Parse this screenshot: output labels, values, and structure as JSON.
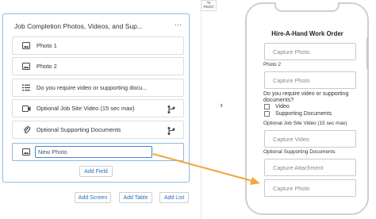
{
  "toolbar": {
    "redo_label": "REDO"
  },
  "editor": {
    "section_title": "Job Completion Photos, Videos, and Sup...",
    "menu_glyph": "…",
    "fields": [
      {
        "label": "Photo 1",
        "icon": "image-icon",
        "branch": false
      },
      {
        "label": "Photo 2",
        "icon": "image-icon",
        "branch": false
      },
      {
        "label": "Do you require video or supporting docu...",
        "icon": "list-icon",
        "branch": false
      },
      {
        "label": "Optional Job Site Video (15 sec max)",
        "icon": "video-icon",
        "branch": true
      },
      {
        "label": "Optional Supporting Documents",
        "icon": "paperclip-icon",
        "branch": true
      }
    ],
    "new_field": {
      "icon": "image-icon",
      "value": "",
      "placeholder": "New Photo"
    },
    "add_field_label": "Add Field"
  },
  "bottom_buttons": {
    "add_screen": "Add Screen",
    "add_table": "Add Table",
    "add_list": "Add List"
  },
  "phone": {
    "title": "Hire-A-Hand Work Order",
    "capture_photo_1": "Capture Photo",
    "photo2_label": "Photo 2",
    "capture_photo_2": "Capture Photo",
    "question_label": "Do you require video or supporting documents?",
    "options": [
      "Video",
      "Supporting Documents"
    ],
    "video_label": "Optional Job Site Video (15 sec max)",
    "capture_video": "Capture Video",
    "documents_label": "Optional Supporting Documents",
    "capture_attachment": "Capture Attachment",
    "capture_photo_3": "Capture Photo"
  },
  "colors": {
    "accent": "#2a6fb8",
    "arrow": "#f0a53c",
    "card_border": "#9ec3e8"
  }
}
